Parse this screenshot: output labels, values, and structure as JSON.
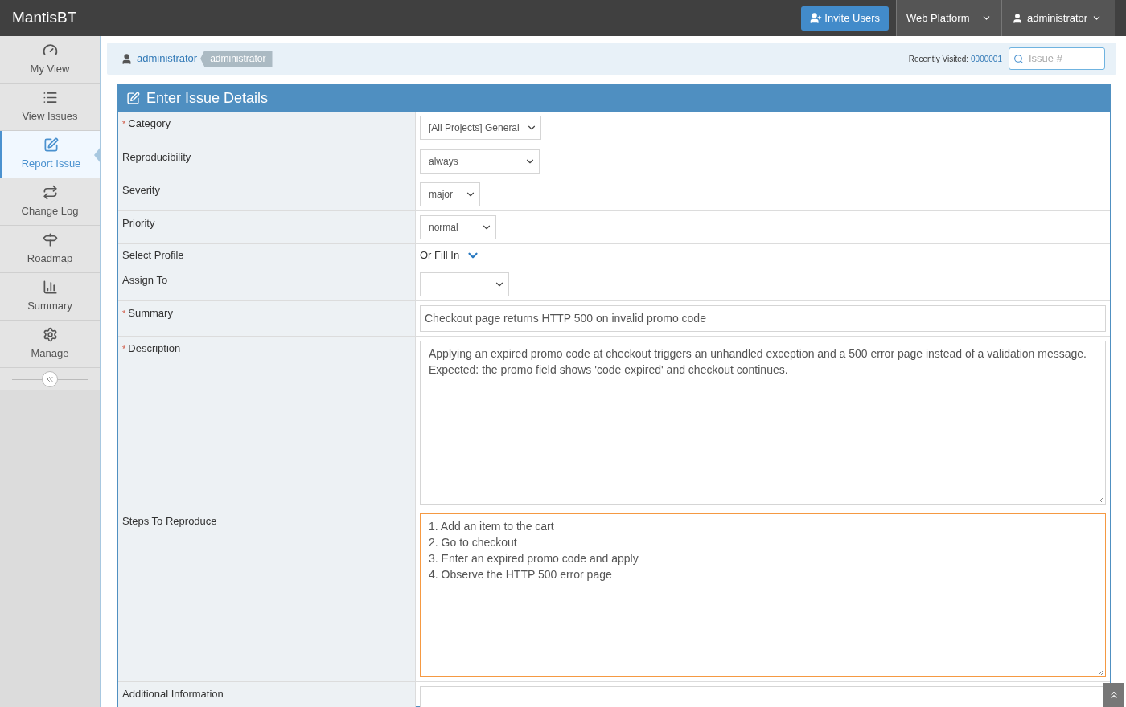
{
  "navbar": {
    "brand": "MantisBT",
    "invite_button": "Invite Users",
    "project_menu": "Web Platform",
    "user_menu": "administrator"
  },
  "sidebar": {
    "items": [
      {
        "label": "My View",
        "selected": false
      },
      {
        "label": "View Issues",
        "selected": false
      },
      {
        "label": "Report Issue",
        "selected": true
      },
      {
        "label": "Change Log",
        "selected": false
      },
      {
        "label": "Roadmap",
        "selected": false
      },
      {
        "label": "Summary",
        "selected": false
      },
      {
        "label": "Manage",
        "selected": false
      }
    ]
  },
  "breadcrumb": {
    "user_link": "administrator",
    "role_badge": "administrator",
    "recently_visited_label": "Recently Visited:",
    "recently_visited_link": "0000001",
    "search": {
      "placeholder": "Issue #"
    }
  },
  "form": {
    "title": "Enter Issue Details",
    "rows": [
      {
        "label": "Category",
        "required_mark": "*",
        "kind": "select",
        "value": "[All Projects] General"
      },
      {
        "label": "Reproducibility",
        "kind": "select",
        "value": "always"
      },
      {
        "label": "Severity",
        "kind": "select",
        "value": "major"
      },
      {
        "label": "Priority",
        "kind": "select",
        "value": "normal"
      },
      {
        "label": "Select Profile",
        "kind": "profile",
        "value": "Or Fill In"
      },
      {
        "label": "Assign To",
        "kind": "select",
        "value": ""
      },
      {
        "label": "Summary",
        "required_mark": "*",
        "kind": "text",
        "value": "Checkout page returns HTTP 500 on invalid promo code"
      },
      {
        "label": "Description",
        "required_mark": "*",
        "kind": "textarea",
        "focused": false,
        "value": "Applying an expired promo code at checkout triggers an unhandled exception and a 500 error page instead of a validation message. Expected: the promo field shows 'code expired' and checkout continues."
      },
      {
        "label": "Steps To Reproduce",
        "kind": "textarea",
        "focused": true,
        "value": "1. Add an item to the cart\n2. Go to checkout\n3. Enter an expired promo code and apply\n4. Observe the HTTP 500 error page"
      },
      {
        "label": "Additional Information",
        "kind": "textarea",
        "focused": false,
        "value": ""
      }
    ]
  }
}
